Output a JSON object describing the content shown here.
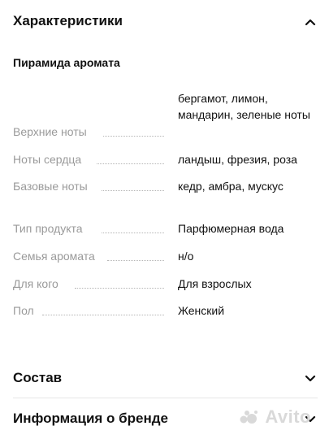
{
  "characteristics": {
    "title": "Характеристики",
    "aroma_pyramid": {
      "title": "Пирамида аромата",
      "rows": [
        {
          "label": "Верхние ноты",
          "value": "бергамот, лимон, мандарин, зеленые ноты"
        },
        {
          "label": "Ноты сердца",
          "value": "ландыш, фрезия, роза"
        },
        {
          "label": "Базовые ноты",
          "value": "кедр, амбра, мускус"
        }
      ]
    },
    "rows": [
      {
        "label": "Тип продукта",
        "value": "Парфюмерная вода"
      },
      {
        "label": "Семья аромата",
        "value": "н/о"
      },
      {
        "label": "Для кого",
        "value": "Для взрослых"
      },
      {
        "label": "Пол",
        "value": "Женский"
      }
    ]
  },
  "composition": {
    "title": "Состав"
  },
  "brand_info": {
    "title": "Информация о бренде"
  },
  "watermark": {
    "text": "Avito"
  },
  "icons": {
    "expanded": "chevron-up-icon",
    "collapsed": "chevron-down-icon"
  }
}
